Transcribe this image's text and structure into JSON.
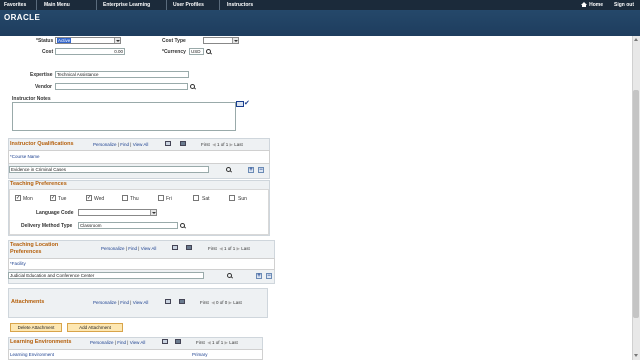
{
  "nav": {
    "crumbs": [
      "Favorites",
      "Main Menu",
      "Enterprise Learning",
      "User Profiles",
      "Instructors"
    ],
    "home_label": "Home",
    "signout_label": "Sign out"
  },
  "brand": {
    "logo_text": "ORACLE"
  },
  "fields": {
    "status_label": "*Status",
    "status_value": "Active",
    "cost_type_label": "Cost Type",
    "cost_type_value": "",
    "cost_label": "Cost",
    "cost_value": "0.00",
    "currency_label": "*Currency",
    "currency_value": "USD",
    "expertise_label": "Expertise",
    "expertise_value": "Technical Assistance",
    "vendor_label": "Vendor",
    "vendor_value": "",
    "notes_label": "Instructor Notes",
    "notes_value": ""
  },
  "grid_nav": {
    "personalize": "Personalize",
    "find": "Find",
    "view_all": "View All",
    "first": "First",
    "range": "1 of 1",
    "last": "Last",
    "separator": "|"
  },
  "qualifications": {
    "title": "Instructor Qualifications",
    "column": "*Course Name",
    "row_value": "Evidence in Criminal Cases"
  },
  "teaching_prefs": {
    "title": "Teaching Preferences",
    "days": [
      {
        "label": "Mon",
        "checked": true
      },
      {
        "label": "Tue",
        "checked": true
      },
      {
        "label": "Wed",
        "checked": true
      },
      {
        "label": "Thu",
        "checked": false
      },
      {
        "label": "Fri",
        "checked": false
      },
      {
        "label": "Sat",
        "checked": false
      },
      {
        "label": "Sun",
        "checked": false
      }
    ],
    "language_label": "Language Code",
    "language_value": "",
    "delivery_label": "Delivery Method Type",
    "delivery_value": "Classroom"
  },
  "location_prefs": {
    "title_line1": "Teaching Location",
    "title_line2": "Preferences",
    "column": "*Facility",
    "row_value": "Judicial Education and Conference Center"
  },
  "attachments": {
    "title": "Attachments",
    "range": "0 of 0",
    "delete_label": "Delete Attachment",
    "add_label": "Add Attachment"
  },
  "environments": {
    "title": "Learning Environments",
    "col_env": "Learning Environment",
    "col_primary": "Primary"
  },
  "colors": {
    "header_orange": "#b5600c",
    "link_blue": "#1a3f8f",
    "nav_dark": "#1b2a3a"
  }
}
